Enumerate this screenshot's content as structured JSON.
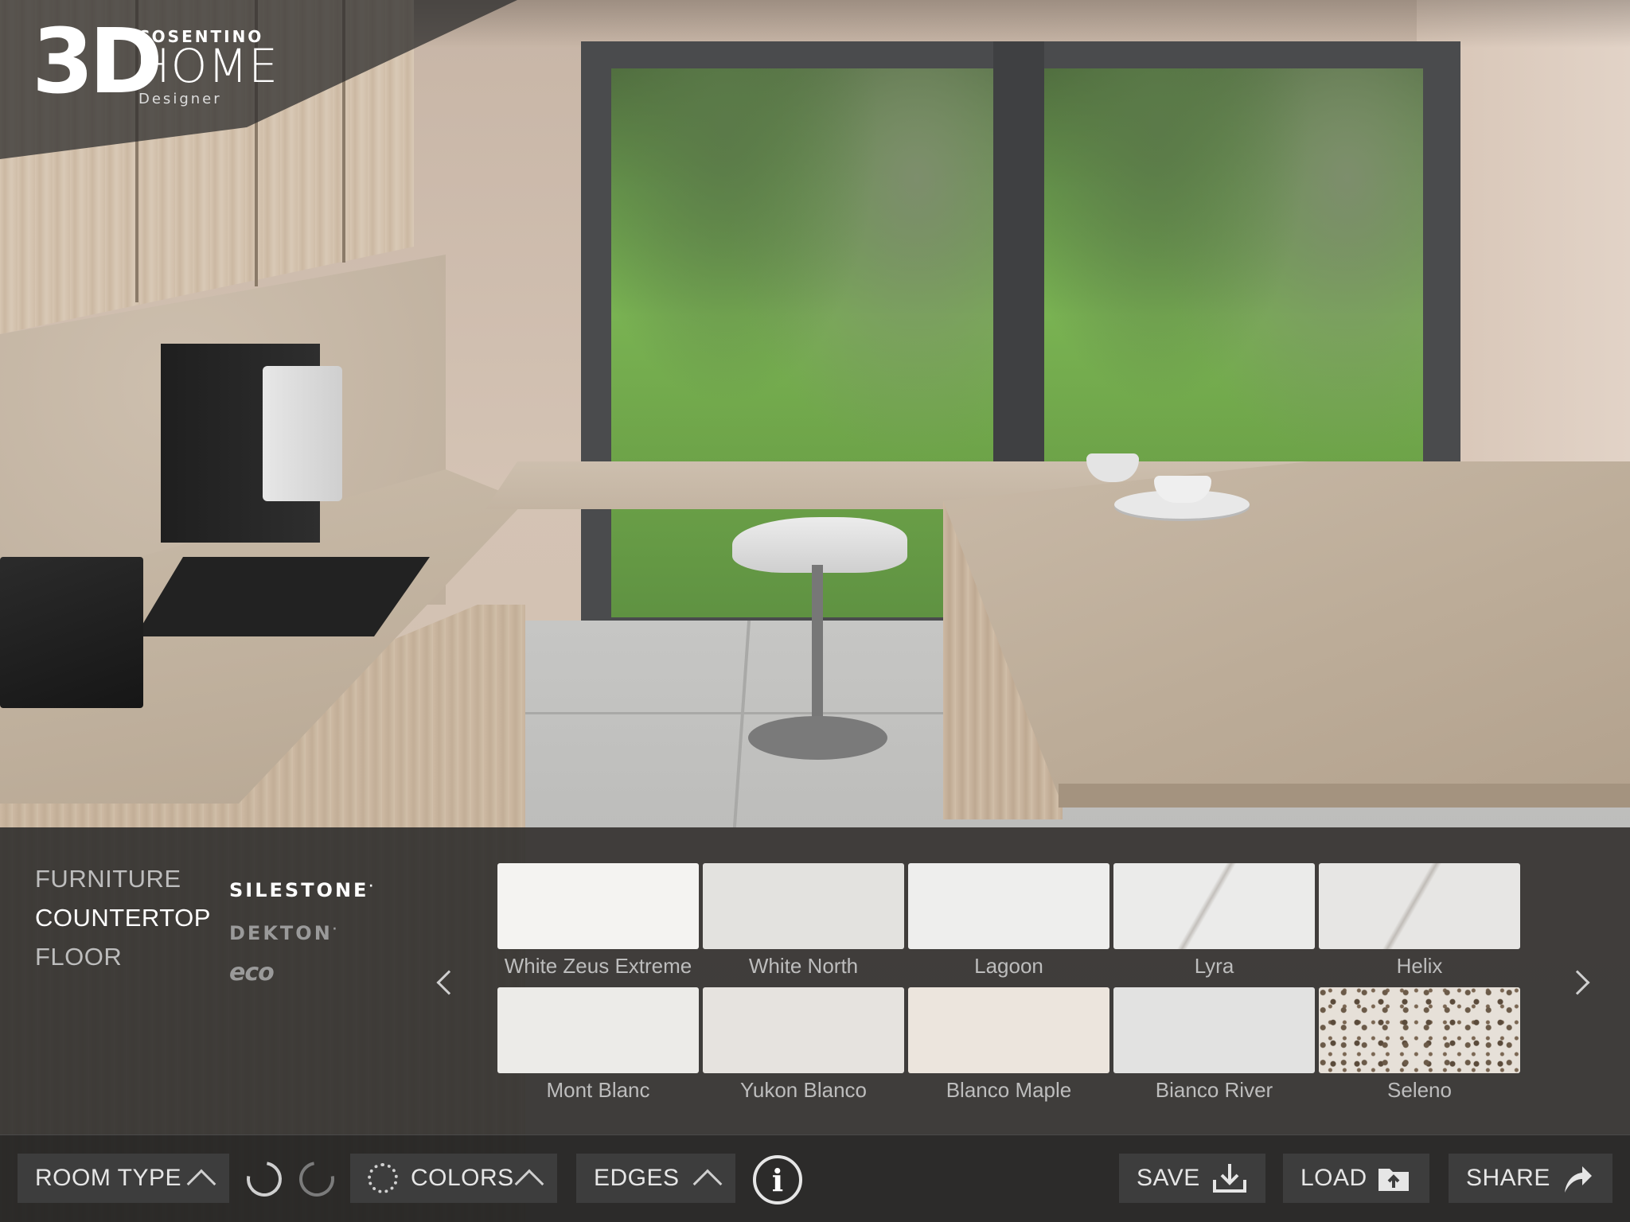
{
  "logo": {
    "mark": "3D",
    "brand": "COSENTINO",
    "product": "HOME",
    "sub": "Designer"
  },
  "categories": [
    {
      "label": "FURNITURE",
      "active": false
    },
    {
      "label": "COUNTERTOP",
      "active": true
    },
    {
      "label": "FLOOR",
      "active": false
    }
  ],
  "brands": [
    {
      "label": "SILESTONE",
      "mark": "·",
      "selected": true
    },
    {
      "label": "DEKTON",
      "mark": "·",
      "selected": false
    },
    {
      "label": "eco",
      "selected": false
    }
  ],
  "materials": [
    {
      "name": "White Zeus Extreme",
      "color": "#f4f3f1"
    },
    {
      "name": "White North",
      "color": "#e3e2df"
    },
    {
      "name": "Lagoon",
      "color": "#eeeeed"
    },
    {
      "name": "Lyra",
      "color": "#ebebea"
    },
    {
      "name": "Helix",
      "color": "#e7e6e4"
    },
    {
      "name": "Mont Blanc",
      "color": "#ecebe8"
    },
    {
      "name": "Yukon Blanco",
      "color": "#e6e3df"
    },
    {
      "name": "Blanco Maple",
      "color": "#ece5dd"
    },
    {
      "name": "Bianco River",
      "color": "#e2e2e1"
    },
    {
      "name": "Seleno",
      "color": "#e6e0d8"
    }
  ],
  "toolbar": {
    "room_type": "ROOM TYPE",
    "colors": "COLORS",
    "edges": "EDGES",
    "info": "i",
    "save": "SAVE",
    "load": "LOAD",
    "share": "SHARE"
  }
}
